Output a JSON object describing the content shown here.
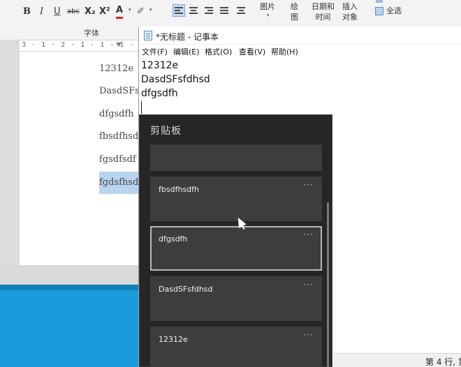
{
  "word": {
    "toolbar": {
      "bold": "B",
      "italic": "I",
      "underline": "U",
      "strikethrough": "abc",
      "subscript": "X₂",
      "superscript": "X²",
      "font_color": "A",
      "highlight": "✐",
      "font_group_label": "字体"
    },
    "insert": {
      "picture_label": "图片",
      "drawing_label": "绘\n图",
      "datetime_label": "日期和\n时间",
      "insert_object_label": "插入\n对象",
      "select_all_label": "全选"
    },
    "ruler": "3 · 1 · 2 · 1 · 1 · 1 ·",
    "document_lines": [
      "12312e",
      "DasdSFsf",
      "dfgsdfh",
      "fbsdfhsd",
      "fgsdfsdf",
      "fgdsfhsd"
    ]
  },
  "notepad": {
    "title": "*无标题 - 记事本",
    "menu": [
      "文件(F)",
      "编辑(E)",
      "格式(O)",
      "查看(V)",
      "帮助(H)"
    ],
    "lines": [
      "12312e",
      "DasdSFsfdhsd",
      "dfgsdfh"
    ],
    "status": "第 4 行, 第"
  },
  "clipboard": {
    "title": "剪贴板",
    "more_label": "···",
    "items": [
      "",
      "fbsdfhsdfh",
      "dfgsdfh",
      "DasdSFsfdhsd",
      "12312e"
    ],
    "focused_index": 2
  }
}
